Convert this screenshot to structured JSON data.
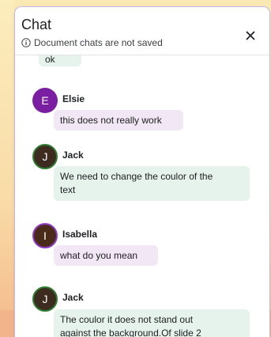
{
  "panel": {
    "title": "Chat",
    "notice": "Document chats are not saved",
    "close_label": "×"
  },
  "messages": [
    {
      "type": "partial",
      "text": "ok",
      "style": "green"
    },
    {
      "sender": "Elsie",
      "initial": "E",
      "text": "this does not really work",
      "style": "purple",
      "avatar_color": "#7b1fa2"
    },
    {
      "sender": "Jack",
      "initial": "J",
      "text_lines": [
        "We need to change the coulor of the",
        "text"
      ],
      "style": "green",
      "avatar_color": "#3d2b1f"
    },
    {
      "sender": "Isabella",
      "initial": "I",
      "text": "what do you mean",
      "style": "purple",
      "avatar_color": "#4a2b1a"
    },
    {
      "sender": "Jack",
      "initial": "J",
      "text_lines": [
        "The coulor it does not stand out",
        "against the background.Of slide 2"
      ],
      "style": "green",
      "avatar_color": "#3d2b1f"
    }
  ],
  "colors": {
    "accent_border": "#c8b6e8",
    "purple_bubble": "#f1e7f5",
    "green_bubble": "#e6f2ec"
  }
}
